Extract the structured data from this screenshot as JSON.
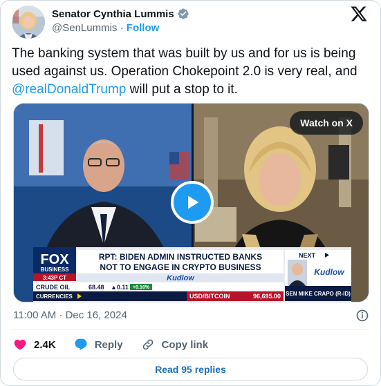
{
  "author": {
    "display_name": "Senator Cynthia Lummis",
    "handle": "@SenLummis",
    "separator": " · ",
    "follow_label": "Follow"
  },
  "tweet": {
    "text_before": "The banking system that was built by us and for us is being used against us. Operation Chokepoint 2.0 is very real, and ",
    "mention": "@realDonaldTrump",
    "text_after": " will put a stop to it."
  },
  "video": {
    "watch_label": "Watch on X",
    "lower_third": {
      "network": "FOX",
      "network_sub": "BUSINESS",
      "time": "3:43P CT",
      "headline_1": "RPT: BIDEN ADMIN INSTRUCTED BANKS",
      "headline_2": "NOT TO ENGAGE IN CRYPTO BUSINESS",
      "show": "Kudlow",
      "ticker_1_label": "CRUDE OIL",
      "ticker_1_value": "68.48",
      "ticker_1_change": "▲0.11",
      "ticker_1_pct": "+0.16%",
      "ticker_2_label": "CURRENCIES",
      "btc_label": "USD/BITCOIN",
      "btc_value": "96,695.00",
      "next_label": "NEXT",
      "next_show": "Kudlow",
      "next_guest": "SEN MIKE CRAPO (R-ID)"
    }
  },
  "meta": {
    "timestamp": "11:00 AM · Dec 16, 2024"
  },
  "actions": {
    "likes": "2.4K",
    "reply_label": "Reply",
    "copy_link_label": "Copy link"
  },
  "read_replies_label": "Read 95 replies",
  "colors": {
    "accent": "#1d9bf0",
    "like": "#f91880",
    "text": "#0f1419",
    "muted": "#536471"
  }
}
